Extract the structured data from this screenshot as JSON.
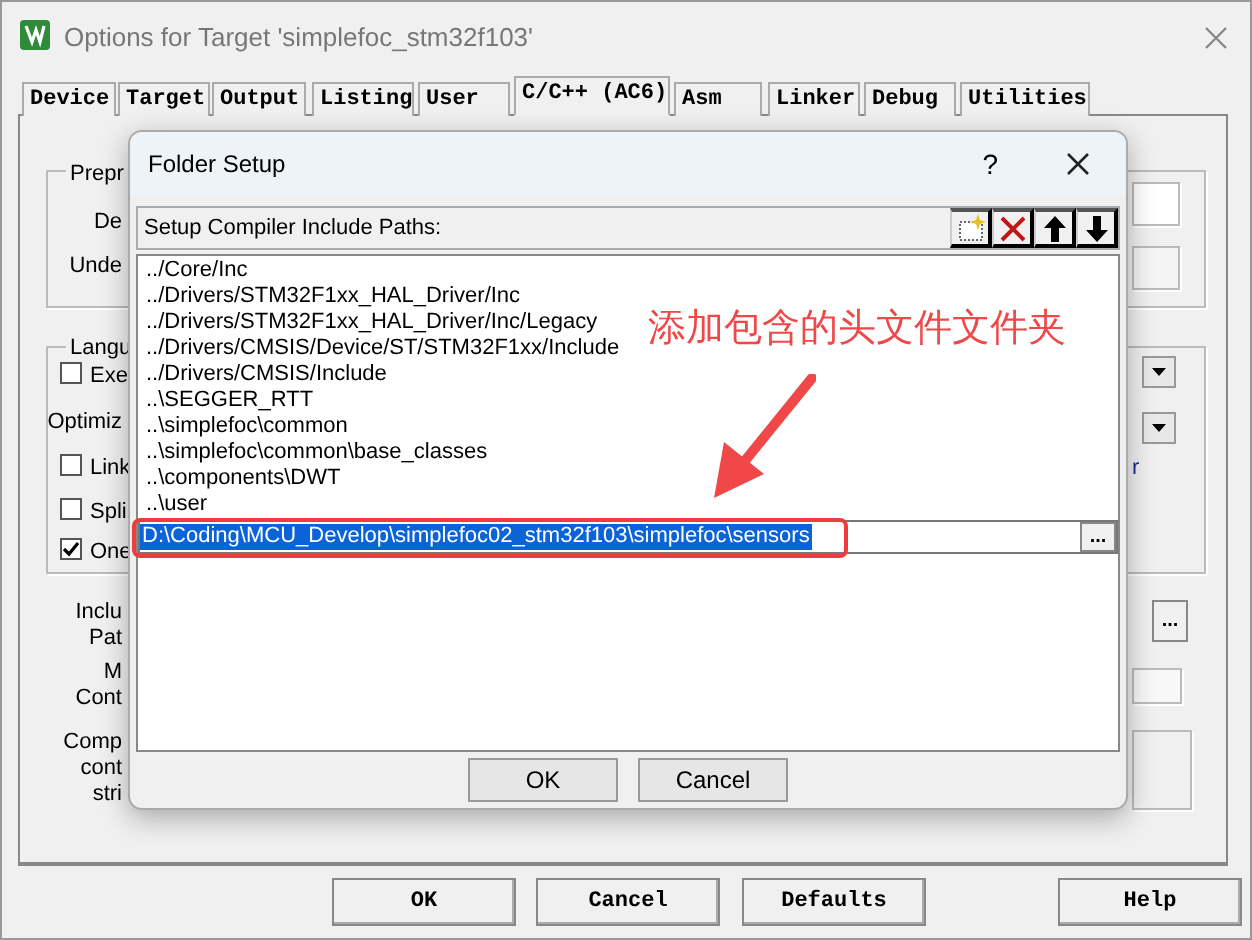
{
  "window": {
    "title": "Options for Target 'simplefoc_stm32f103'"
  },
  "tabs": [
    {
      "label": "Device",
      "selected": false
    },
    {
      "label": "Target",
      "selected": false
    },
    {
      "label": "Output",
      "selected": false
    },
    {
      "label": "Listing",
      "selected": false
    },
    {
      "label": "User",
      "selected": false
    },
    {
      "label": "C/C++ (AC6)",
      "selected": true
    },
    {
      "label": "Asm",
      "selected": false
    },
    {
      "label": "Linker",
      "selected": false
    },
    {
      "label": "Debug",
      "selected": false
    },
    {
      "label": "Utilities",
      "selected": false
    }
  ],
  "background": {
    "group_labels": [
      "Prepr",
      "Langu"
    ],
    "labels": [
      "De",
      "Unde",
      "Optimiz",
      "Inclu\nPat",
      "M\nCont",
      "Comp\ncont\nstri",
      "r"
    ],
    "checkboxes": [
      {
        "label": "Exe",
        "checked": false
      },
      {
        "label": "Link",
        "checked": false
      },
      {
        "label": "Spli",
        "checked": false
      },
      {
        "label": "One",
        "checked": true
      }
    ],
    "browse_button": "..."
  },
  "buttons": [
    "OK",
    "Cancel",
    "Defaults",
    "Help"
  ],
  "dialog": {
    "title": "Folder Setup",
    "help": "?",
    "header": "Setup Compiler Include Paths:",
    "paths": [
      "../Core/Inc",
      "../Drivers/STM32F1xx_HAL_Driver/Inc",
      "../Drivers/STM32F1xx_HAL_Driver/Inc/Legacy",
      "../Drivers/CMSIS/Device/ST/STM32F1xx/Include",
      "../Drivers/CMSIS/Include",
      "..\\SEGGER_RTT",
      "..\\simplefoc\\common",
      "..\\simplefoc\\common\\base_classes",
      "..\\components\\DWT",
      "..\\user"
    ],
    "editing_path": "D:\\Coding\\MCU_Develop\\simplefoc02_stm32f103\\simplefoc\\sensors",
    "browse_button": "...",
    "buttons": [
      "OK",
      "Cancel"
    ]
  },
  "annotation": {
    "text": "添加包含的头文件文件夹"
  }
}
